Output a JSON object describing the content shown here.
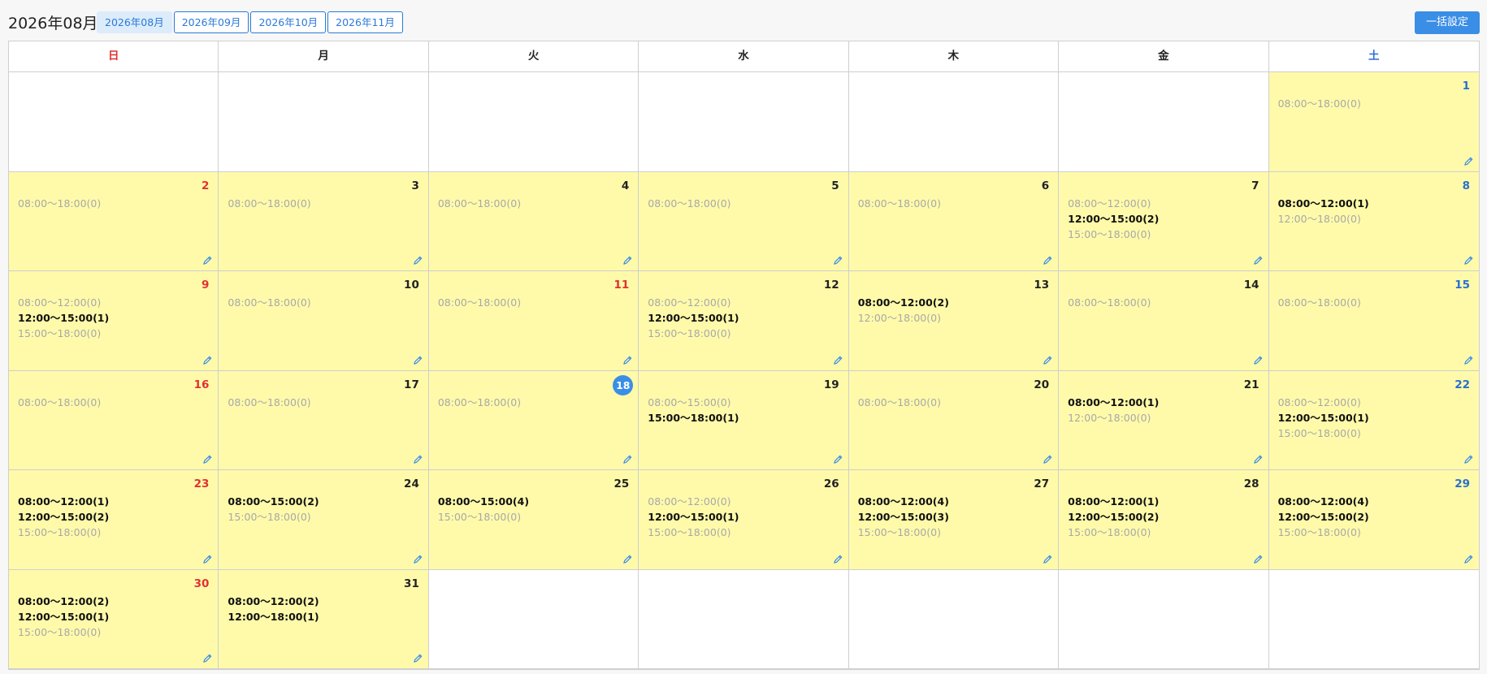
{
  "header": {
    "current_month": "2026年08月",
    "months": [
      "2026年08月",
      "2026年09月",
      "2026年10月",
      "2026年11月"
    ],
    "active_month_index": 0,
    "bulk_button": "一括設定"
  },
  "weekdays": [
    "日",
    "月",
    "火",
    "水",
    "木",
    "金",
    "土"
  ],
  "today": 18,
  "colors": {
    "accent": "#3a8ee6",
    "sunday": "#e03131",
    "saturday": "#2a6fd0",
    "day_bg": "#fffaaa"
  },
  "edit_icon": "pencil-icon",
  "days": [
    {
      "day": 1,
      "slots": [
        {
          "time": "08:00〜18:00(0)",
          "booked": false
        }
      ]
    },
    {
      "day": 2,
      "slots": [
        {
          "time": "08:00〜18:00(0)",
          "booked": false
        }
      ]
    },
    {
      "day": 3,
      "slots": [
        {
          "time": "08:00〜18:00(0)",
          "booked": false
        }
      ]
    },
    {
      "day": 4,
      "slots": [
        {
          "time": "08:00〜18:00(0)",
          "booked": false
        }
      ]
    },
    {
      "day": 5,
      "slots": [
        {
          "time": "08:00〜18:00(0)",
          "booked": false
        }
      ]
    },
    {
      "day": 6,
      "slots": [
        {
          "time": "08:00〜18:00(0)",
          "booked": false
        }
      ]
    },
    {
      "day": 7,
      "slots": [
        {
          "time": "08:00〜12:00(0)",
          "booked": false
        },
        {
          "time": "12:00〜15:00(2)",
          "booked": true
        },
        {
          "time": "15:00〜18:00(0)",
          "booked": false
        }
      ]
    },
    {
      "day": 8,
      "slots": [
        {
          "time": "08:00〜12:00(1)",
          "booked": true
        },
        {
          "time": "12:00〜18:00(0)",
          "booked": false
        }
      ]
    },
    {
      "day": 9,
      "slots": [
        {
          "time": "08:00〜12:00(0)",
          "booked": false
        },
        {
          "time": "12:00〜15:00(1)",
          "booked": true
        },
        {
          "time": "15:00〜18:00(0)",
          "booked": false
        }
      ]
    },
    {
      "day": 10,
      "slots": [
        {
          "time": "08:00〜18:00(0)",
          "booked": false
        }
      ]
    },
    {
      "day": 11,
      "holiday": true,
      "slots": [
        {
          "time": "08:00〜18:00(0)",
          "booked": false
        }
      ]
    },
    {
      "day": 12,
      "slots": [
        {
          "time": "08:00〜12:00(0)",
          "booked": false
        },
        {
          "time": "12:00〜15:00(1)",
          "booked": true
        },
        {
          "time": "15:00〜18:00(0)",
          "booked": false
        }
      ]
    },
    {
      "day": 13,
      "slots": [
        {
          "time": "08:00〜12:00(2)",
          "booked": true
        },
        {
          "time": "12:00〜18:00(0)",
          "booked": false
        }
      ]
    },
    {
      "day": 14,
      "slots": [
        {
          "time": "08:00〜18:00(0)",
          "booked": false
        }
      ]
    },
    {
      "day": 15,
      "slots": [
        {
          "time": "08:00〜18:00(0)",
          "booked": false
        }
      ]
    },
    {
      "day": 16,
      "slots": [
        {
          "time": "08:00〜18:00(0)",
          "booked": false
        }
      ]
    },
    {
      "day": 17,
      "slots": [
        {
          "time": "08:00〜18:00(0)",
          "booked": false
        }
      ]
    },
    {
      "day": 18,
      "slots": [
        {
          "time": "08:00〜18:00(0)",
          "booked": false
        }
      ]
    },
    {
      "day": 19,
      "slots": [
        {
          "time": "08:00〜15:00(0)",
          "booked": false
        },
        {
          "time": "15:00〜18:00(1)",
          "booked": true
        }
      ]
    },
    {
      "day": 20,
      "slots": [
        {
          "time": "08:00〜18:00(0)",
          "booked": false
        }
      ]
    },
    {
      "day": 21,
      "slots": [
        {
          "time": "08:00〜12:00(1)",
          "booked": true
        },
        {
          "time": "12:00〜18:00(0)",
          "booked": false
        }
      ]
    },
    {
      "day": 22,
      "slots": [
        {
          "time": "08:00〜12:00(0)",
          "booked": false
        },
        {
          "time": "12:00〜15:00(1)",
          "booked": true
        },
        {
          "time": "15:00〜18:00(0)",
          "booked": false
        }
      ]
    },
    {
      "day": 23,
      "slots": [
        {
          "time": "08:00〜12:00(1)",
          "booked": true
        },
        {
          "time": "12:00〜15:00(2)",
          "booked": true
        },
        {
          "time": "15:00〜18:00(0)",
          "booked": false
        }
      ]
    },
    {
      "day": 24,
      "slots": [
        {
          "time": "08:00〜15:00(2)",
          "booked": true
        },
        {
          "time": "15:00〜18:00(0)",
          "booked": false
        }
      ]
    },
    {
      "day": 25,
      "slots": [
        {
          "time": "08:00〜15:00(4)",
          "booked": true
        },
        {
          "time": "15:00〜18:00(0)",
          "booked": false
        }
      ]
    },
    {
      "day": 26,
      "slots": [
        {
          "time": "08:00〜12:00(0)",
          "booked": false
        },
        {
          "time": "12:00〜15:00(1)",
          "booked": true
        },
        {
          "time": "15:00〜18:00(0)",
          "booked": false
        }
      ]
    },
    {
      "day": 27,
      "slots": [
        {
          "time": "08:00〜12:00(4)",
          "booked": true
        },
        {
          "time": "12:00〜15:00(3)",
          "booked": true
        },
        {
          "time": "15:00〜18:00(0)",
          "booked": false
        }
      ]
    },
    {
      "day": 28,
      "slots": [
        {
          "time": "08:00〜12:00(1)",
          "booked": true
        },
        {
          "time": "12:00〜15:00(2)",
          "booked": true
        },
        {
          "time": "15:00〜18:00(0)",
          "booked": false
        }
      ]
    },
    {
      "day": 29,
      "slots": [
        {
          "time": "08:00〜12:00(4)",
          "booked": true
        },
        {
          "time": "12:00〜15:00(2)",
          "booked": true
        },
        {
          "time": "15:00〜18:00(0)",
          "booked": false
        }
      ]
    },
    {
      "day": 30,
      "slots": [
        {
          "time": "08:00〜12:00(2)",
          "booked": true
        },
        {
          "time": "12:00〜15:00(1)",
          "booked": true
        },
        {
          "time": "15:00〜18:00(0)",
          "booked": false
        }
      ]
    },
    {
      "day": 31,
      "slots": [
        {
          "time": "08:00〜12:00(2)",
          "booked": true
        },
        {
          "time": "12:00〜18:00(1)",
          "booked": true
        }
      ]
    }
  ]
}
